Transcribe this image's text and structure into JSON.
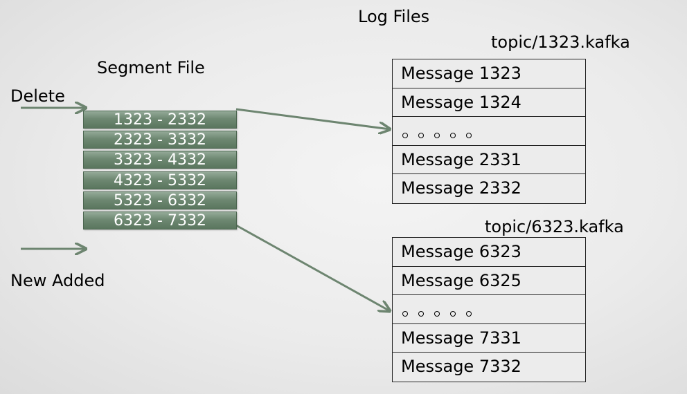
{
  "title": "Log Files",
  "segment_file": {
    "label": "Segment File",
    "delete_label": "Delete",
    "new_added_label": "New Added",
    "segments": [
      "1323 - 2332",
      "2323 - 3332",
      "3323 - 4332",
      "4323 - 5332",
      "5323 - 6332",
      "6323 - 7332"
    ]
  },
  "log_files": [
    {
      "name": "topic/1323.kafka",
      "rows": [
        "Message 1323",
        "Message 1324",
        "",
        "Message 2331",
        "Message 2332"
      ]
    },
    {
      "name": "topic/6323.kafka",
      "rows": [
        "Message 6323",
        "Message 6325",
        "",
        "Message 7331",
        "Message 7332"
      ]
    }
  ],
  "colors": {
    "segment": "#6e8872",
    "arrow": "#6d8570"
  }
}
